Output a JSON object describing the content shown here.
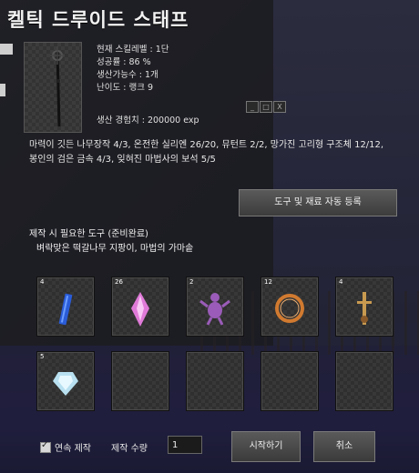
{
  "window": {
    "title": "켈틱 드루이드 스태프"
  },
  "item_info": {
    "skill_level": "현재 스킬레벨 : 1단",
    "success_rate": "성공률 : 86 %",
    "producible": "생산가능수 : 1개",
    "difficulty": "난이도 : 랭크 9",
    "exp": "생산 경험치 : 200000 exp"
  },
  "materials_text": "마력이 깃든 나무장작 4/3, 온전한 실리엔 26/20, 뮤턴트 2/2, 망가진 고리형 구조체 12/12, 봉인의 검은 금속 4/3, 잊혀진 마법사의 보석 5/5",
  "buttons": {
    "auto_register": "도구 및 재료 자동 등록",
    "start": "시작하기",
    "cancel": "취소"
  },
  "tools": {
    "header": "제작 시 필요한 도구 (준비완료)",
    "list": "벼락맞은 떡갈나무 지팡이, 마법의 가마솥"
  },
  "slots": [
    {
      "count": "4",
      "icon": "blue-wood-icon",
      "color": "#2a5cd8"
    },
    {
      "count": "26",
      "icon": "pink-crystal-icon",
      "color": "#e07ad8"
    },
    {
      "count": "2",
      "icon": "purple-mutant-icon",
      "color": "#9a5cb8"
    },
    {
      "count": "12",
      "icon": "ring-structure-icon",
      "color": "#d07a30"
    },
    {
      "count": "4",
      "icon": "metal-key-icon",
      "color": "#c89a50"
    },
    {
      "count": "5",
      "icon": "gem-icon",
      "color": "#b8e0f0"
    },
    {
      "count": "",
      "icon": ""
    },
    {
      "count": "",
      "icon": ""
    },
    {
      "count": "",
      "icon": ""
    },
    {
      "count": "",
      "icon": ""
    }
  ],
  "footer": {
    "continuous_label": "연속 제작",
    "continuous_checked": true,
    "quantity_label": "제작 수량",
    "quantity_value": "1"
  },
  "mini_buttons": [
    "_",
    "□",
    "X"
  ]
}
